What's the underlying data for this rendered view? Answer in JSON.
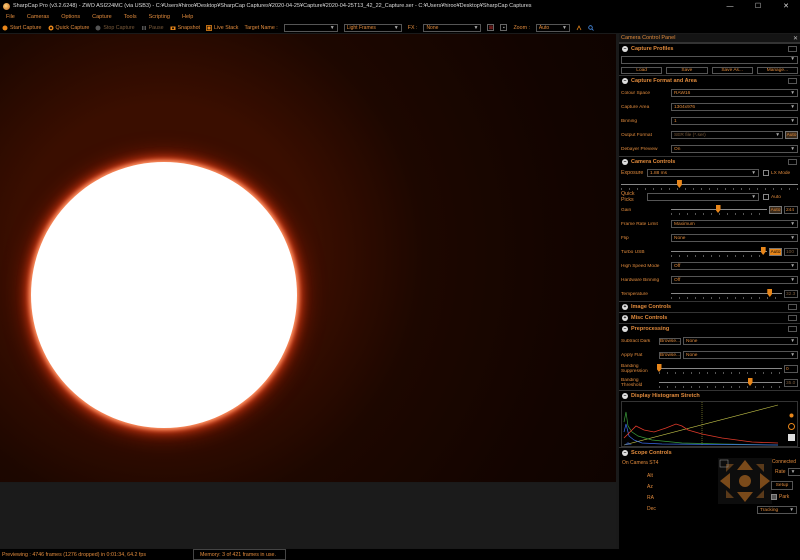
{
  "window": {
    "title": "SharpCap Pro (v3.2.6248) - ZWO ASI224MC (via USB3) - C:¥Users¥hiroo¥Desktop¥SharpCap Captures¥2020-04-25¥Capture¥2020-04-25T13_42_22_Capture.ser - C:¥Users¥hiroo¥Desktop¥SharpCap Captures",
    "minimize": "—",
    "maximize": "☐",
    "close": "✕"
  },
  "menu": [
    "File",
    "Cameras",
    "Options",
    "Capture",
    "Tools",
    "Scripting",
    "Help"
  ],
  "toolbar": {
    "start_capture": "Start Capture",
    "quick_capture": "Quick Capture",
    "stop_capture": "Stop Capture",
    "pause": "Pause",
    "snapshot": "Snapshot",
    "live_stack": "Live Stack",
    "target_name_label": "Target Name :",
    "target_name_value": "",
    "frame_type": "Light Frames",
    "fx_label": "FX :",
    "fx_value": "None",
    "zoom_label": "Zoom :",
    "zoom_value": "Auto"
  },
  "status": {
    "previewing": "Previewing : 4746 frames (1276 dropped) in 0:01:34, 64.2 fps",
    "memory": "Memory: 3 of 421 frames in use."
  },
  "panel": {
    "title": "Camera Control Panel",
    "close": "✕",
    "capture_profiles": {
      "header": "Capture Profiles",
      "profile_value": "",
      "load": "Load",
      "save": "Save",
      "save_as": "Save As...",
      "manage": "Manage..."
    },
    "capture_format": {
      "header": "Capture Format and Area",
      "rows": [
        {
          "label": "Colour Space",
          "value": "RAW16"
        },
        {
          "label": "Capture Area",
          "value": "1304x976"
        },
        {
          "label": "Binning",
          "value": "1"
        },
        {
          "label": "Output Format",
          "value": "SER file (*.ser)"
        },
        {
          "label": "Debayer Preview",
          "value": "On"
        }
      ],
      "output_auto": "Auto"
    },
    "camera_controls": {
      "header": "Camera Controls",
      "exposure_label": "Exposure",
      "exposure_value": "1.88 ms",
      "lx_mode": "LX Mode",
      "quick_picks_label": "Quick Picks",
      "quick_picks_value": "",
      "quick_auto": "Auto",
      "gain_label": "Gain",
      "gain_auto": "Auto",
      "gain_value": "244",
      "frame_rate_label": "Frame Rate Limit",
      "frame_rate_value": "Maximum",
      "flip_label": "Flip",
      "flip_value": "None",
      "turbo_label": "Turbo USB",
      "turbo_auto": "Auto",
      "turbo_value": "100",
      "high_speed_label": "High Speed Mode",
      "high_speed_value": "Off",
      "hardware_binning_label": "Hardware Binning",
      "hardware_binning_value": "Off",
      "temperature_label": "Temperature",
      "temperature_value": "32.3",
      "sliders": {
        "exposure": 0.33,
        "gain": 0.49,
        "turbo": 0.96,
        "temperature": 0.89
      }
    },
    "image_controls": {
      "header": "Image Controls"
    },
    "misc_controls": {
      "header": "Misc Controls"
    },
    "preprocessing": {
      "header": "Preprocessing",
      "subtract_dark_label": "Subtract Dark",
      "subtract_dark_browse": "Browse...",
      "subtract_dark_value": "None",
      "apply_flat_label": "Apply Flat",
      "apply_flat_browse": "Browse...",
      "apply_flat_value": "None",
      "banding_suppression_label": "Banding Suppression",
      "banding_suppression_value": "0",
      "banding_threshold_label": "Banding Threshold",
      "banding_threshold_value": "35.0",
      "sliders": {
        "suppression": 0.0,
        "threshold": 0.74
      }
    },
    "histogram": {
      "header": "Display Histogram Stretch"
    },
    "scope_controls": {
      "header": "Scope Controls",
      "connected": "Connected",
      "device": "On Camera ST4",
      "rate_label": "Rate",
      "setup": "Setup",
      "park": "Park",
      "tracking": "Tracking",
      "axes": [
        "Alt",
        "Az",
        "RA",
        "Dec"
      ]
    }
  },
  "colors": {
    "accent": "#e08a3c",
    "slider_thumb": "#e8861a",
    "background": "#000000"
  }
}
